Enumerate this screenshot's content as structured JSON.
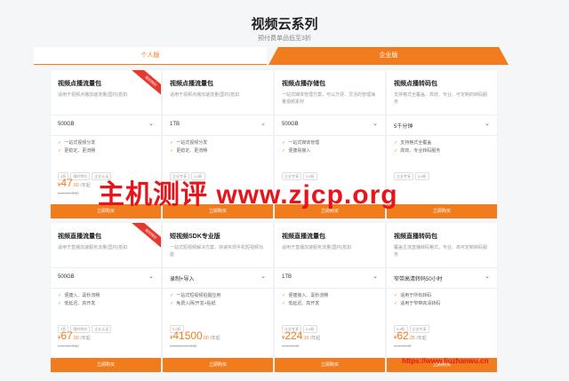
{
  "page": {
    "title": "视频云系列",
    "subtitle": "预付费单品低至3折"
  },
  "tabs": {
    "personal": "个人版",
    "enterprise": "企业版"
  },
  "cards": [
    {
      "title": "视频点播流量包",
      "desc": "适用于视频点播加速流量(国内)抵扣",
      "select": "500GB",
      "features": [
        "一站式视频分发",
        "更稳定、更流畅"
      ],
      "tags": [
        "3折",
        "限时特价",
        "企业认证"
      ],
      "price_int": "47",
      "price_dec": ".50",
      "unit": "/年起",
      "orig": "¥ 47.50 /年起",
      "buy": "立即购买",
      "ribbon": "限时特价"
    },
    {
      "title": "视频点播流量包",
      "desc": "适用于视频点播加速流量(国内)抵扣",
      "select": "1TB",
      "features": [
        "一站式视频分发",
        "更稳定、更流畅"
      ],
      "tags": [
        "企业专享",
        "3.8折"
      ],
      "price_int": "",
      "price_dec": "",
      "unit": "",
      "orig": "",
      "buy": "立即购买",
      "ribbon": ""
    },
    {
      "title": "视频点播存储包",
      "desc": "一站式媒体管理方案，可以方便、灵活的管理海量视频素材",
      "select": "500GB",
      "features": [
        "一站式媒体管理",
        "便捷易接入"
      ],
      "tags": [
        "企业专享",
        "3.8折"
      ],
      "price_int": "",
      "price_dec": "",
      "unit": "",
      "orig": "",
      "buy": "立即购买",
      "ribbon": ""
    },
    {
      "title": "视频点播转码包",
      "desc": "支持格式全覆盖、高效、专业、可定制的转码服务",
      "select": "5千分钟",
      "features": [
        "支持格式全覆盖",
        "高效、专业转码服务"
      ],
      "tags": [
        "企业专享",
        "5.8折"
      ],
      "price_int": "",
      "price_dec": "",
      "unit": "",
      "orig": "",
      "buy": "立即购买",
      "ribbon": ""
    },
    {
      "title": "视频直播流量包",
      "desc": "适用于直播加速服务流量(国内)抵扣",
      "select": "500GB",
      "features": [
        "便捷入、毫秒流畅",
        "低延迟、高开发"
      ],
      "tags": [
        "3折",
        "限时特价",
        "企业认证"
      ],
      "price_int": "67",
      "price_dec": ".50",
      "unit": "/年起",
      "orig": "¥ 67.50 /年起",
      "buy": "立即购买",
      "ribbon": "限时特价"
    },
    {
      "title": "短视频SDK专业版",
      "desc": "一站式短视频解决方案，快速实现手机短视频功能",
      "select": "录制+导入",
      "features": [
        "一站式短视频拍摄应用",
        "免费入网/开发+贴纸"
      ],
      "tags": [
        "5.8折"
      ],
      "price_int": "41500",
      "price_dec": ".00",
      "unit": "/年起",
      "orig": "¥ 69300.00 /年起",
      "buy": "立即购买",
      "ribbon": ""
    },
    {
      "title": "视频直播流量包",
      "desc": "适用于直播加速服务流量(国内)抵扣",
      "select": "1TB",
      "features": [
        "便捷接入、毫秒流畅",
        "低延迟、高开发"
      ],
      "tags": [
        "企业专享",
        "5.8折"
      ],
      "price_int": "224",
      "price_dec": ".10",
      "unit": "/年起",
      "orig": "¥ 40.90 /年",
      "buy": "立即购买",
      "ribbon": ""
    },
    {
      "title": "视频直播转码包",
      "desc": "覆盖主流直播转码格式，专业、高可定制转码服务",
      "select": "窄带高清转码50小时",
      "features": [
        "适用于所有转码",
        "适用于窄带高清转码"
      ],
      "tags": [
        "5.8折",
        "企业专享"
      ],
      "price_int": "62",
      "price_dec": ".25",
      "unit": "/年起",
      "orig": "¥ 12.75 /年",
      "buy": "立即购买",
      "ribbon": ""
    }
  ],
  "watermark": {
    "big": "主机测评 www.zjcp.org",
    "small": "https://www.liuzhanwu.cn"
  },
  "colors": {
    "accent": "#f07c1e",
    "ribbon": "#e8382e",
    "watermark": "#e8141c"
  }
}
